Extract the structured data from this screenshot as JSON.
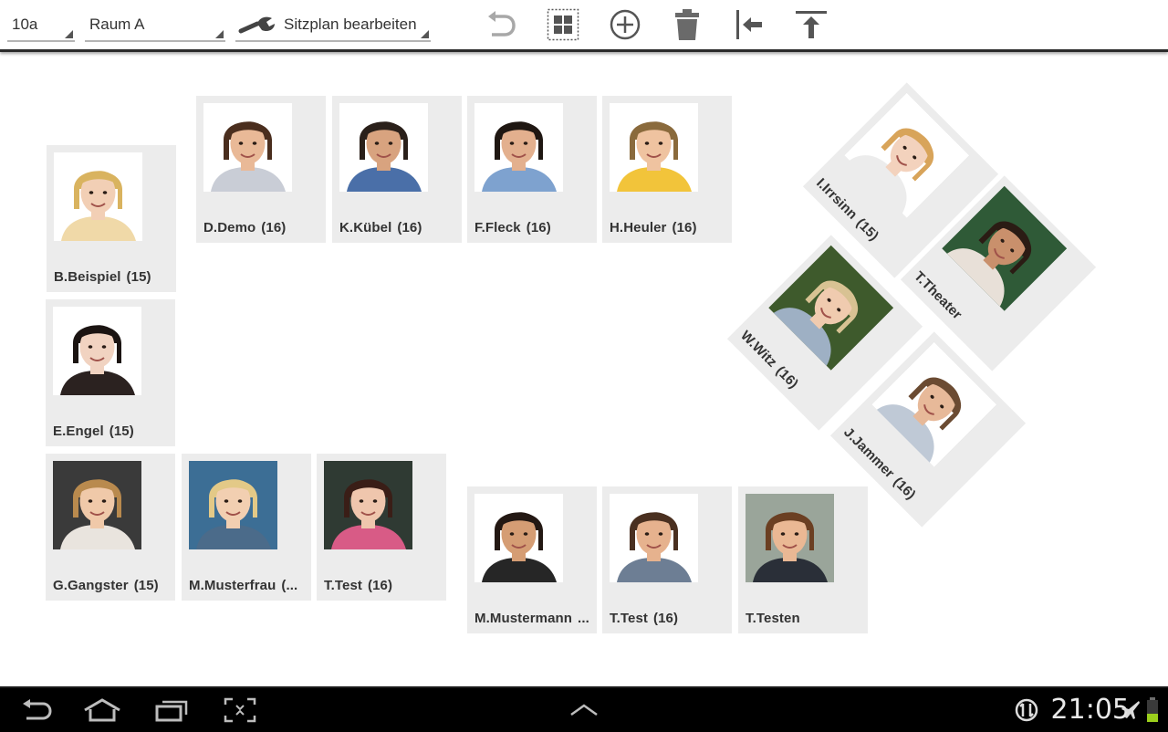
{
  "toolbar": {
    "class_value": "10a",
    "room_value": "Raum A",
    "mode_value": "Sitzplan bearbeiten",
    "icons": [
      "undo-icon",
      "grid-icon",
      "add-icon",
      "trash-icon",
      "align-left-icon",
      "align-top-icon"
    ]
  },
  "students": [
    {
      "name": "B.Beispiel",
      "age": "(15)",
      "hair": "#d9b35f",
      "skin": "#f2cfb5",
      "bg": "#ffffff",
      "shirt": "#f0d9a8"
    },
    {
      "name": "D.Demo",
      "age": "(16)",
      "hair": "#4a2e1e",
      "skin": "#e9b997",
      "bg": "#ffffff",
      "shirt": "#c9cdd6"
    },
    {
      "name": "K.Kübel",
      "age": "(16)",
      "hair": "#2a201a",
      "skin": "#d8a37f",
      "bg": "#ffffff",
      "shirt": "#4a6fa8"
    },
    {
      "name": "F.Fleck",
      "age": "(16)",
      "hair": "#1f1712",
      "skin": "#e3b08e",
      "bg": "#ffffff",
      "shirt": "#7ea2cf"
    },
    {
      "name": "H.Heuler",
      "age": "(16)",
      "hair": "#8a6a3c",
      "skin": "#efc3a0",
      "bg": "#ffffff",
      "shirt": "#f2c43a"
    },
    {
      "name": "E.Engel",
      "age": "(15)",
      "hair": "#1b1412",
      "skin": "#f1d3c1",
      "bg": "#ffffff",
      "shirt": "#2b2220"
    },
    {
      "name": "G.Gangster",
      "age": "(15)",
      "hair": "#b98a4e",
      "skin": "#f0c9a9",
      "bg": "#3a3a3a",
      "shirt": "#e9e4de"
    },
    {
      "name": "M.Musterfrau",
      "age": "(...",
      "hair": "#e3c987",
      "skin": "#f2cfb1",
      "bg": "#3c6e95",
      "shirt": "#4b6b8a"
    },
    {
      "name": "T.Test",
      "age": "(16)",
      "hair": "#3a1e17",
      "skin": "#efc6ad",
      "bg": "#2f3a33",
      "shirt": "#d85b86"
    },
    {
      "name": "M.Mustermann",
      "age": "...",
      "hair": "#231813",
      "skin": "#d59d74",
      "bg": "#ffffff",
      "shirt": "#262626"
    },
    {
      "name": "T.Test",
      "age": "(16)",
      "hair": "#4a3020",
      "skin": "#e6b28e",
      "bg": "#ffffff",
      "shirt": "#6d7e94"
    },
    {
      "name": "T.Testen",
      "age": "",
      "hair": "#6b3f22",
      "skin": "#eab894",
      "bg": "#9aa59a",
      "shirt": "#2a2f38"
    },
    {
      "name": "I.Irrsinn",
      "age": "(15)",
      "hair": "#d8a45a",
      "skin": "#f3d2bd",
      "bg": "#ffffff",
      "shirt": "#ececec"
    },
    {
      "name": "T.Theater",
      "age": "",
      "hair": "#2b1c14",
      "skin": "#c9906c",
      "bg": "#2f5a37",
      "shirt": "#e8e0d8"
    },
    {
      "name": "W.Witz",
      "age": "(16)",
      "hair": "#d8c293",
      "skin": "#f0cbaf",
      "bg": "#3e5a2c",
      "shirt": "#9eb0c4"
    },
    {
      "name": "J.Jammer",
      "age": "(16)",
      "hair": "#6b4b32",
      "skin": "#e7b999",
      "bg": "#ffffff",
      "shirt": "#bfc9d6"
    }
  ],
  "status": {
    "time": "21:05"
  }
}
